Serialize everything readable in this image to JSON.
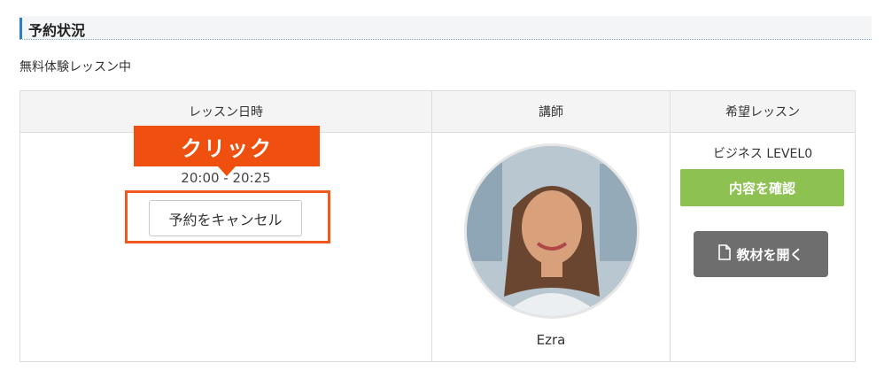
{
  "section": {
    "title": "予約状況"
  },
  "status_text": "無料体験レッスン中",
  "table": {
    "headers": [
      "レッスン日時",
      "講師",
      "希望レッスン"
    ],
    "time_text": "20:00 - 20:25",
    "cancel_label": "予約をキャンセル",
    "teacher_name": "Ezra",
    "course_name": "ビジネス LEVEL0",
    "confirm_label": "内容を確認",
    "material_label": "教材を開く"
  },
  "callout": {
    "label": "クリック"
  },
  "colors": {
    "accent_blue": "#2a7fc1",
    "highlight_orange": "#f0500f",
    "confirm_green": "#8dc152",
    "material_gray": "#6e6e6e"
  },
  "icons": {
    "material": "document-icon"
  }
}
